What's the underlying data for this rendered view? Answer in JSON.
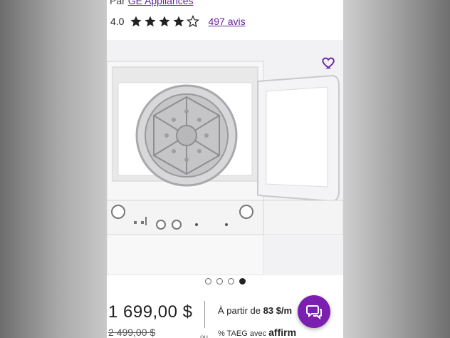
{
  "product": {
    "brand_prefix": "Par",
    "brand_name": "GE Appliances",
    "rating_value": "4.0",
    "rating_stars": 4,
    "rating_max": 5,
    "reviews_label": "497 avis"
  },
  "gallery": {
    "image_count": 4,
    "active_index": 3,
    "favorite_icon": "heart-icon"
  },
  "pricing": {
    "price": "1 699,00 $",
    "old_price": "2 499,00 $",
    "separator_text": "ou",
    "financing_prefix": "À partir de",
    "financing_amount": "83 $/m",
    "financing_rate": "% TAEG avec",
    "financing_brand": "affirm"
  },
  "chat": {
    "icon": "chat-icon"
  },
  "colors": {
    "accent": "#6a1fa0",
    "chat_button": "#7a1fb0"
  }
}
